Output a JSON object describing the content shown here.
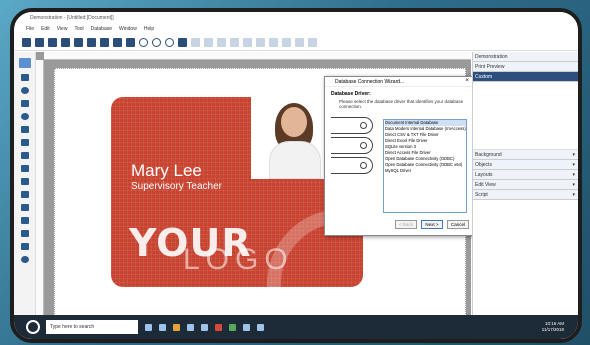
{
  "window": {
    "title": "Demonstration - [Untitled:[Document]]"
  },
  "menu": [
    "File",
    "Edit",
    "View",
    "Tool",
    "Database",
    "Window",
    "Help"
  ],
  "card": {
    "name": "Mary Lee",
    "role": "Supervisory Teacher",
    "logo_line1": "YOUR",
    "logo_line2": "LOGO",
    "bg_color": "#c84330"
  },
  "dialog": {
    "title": "Database Connection Wizard...",
    "close": "×",
    "heading": "Database Driver:",
    "instructions": "Please select the database driver that identifies your database connection.",
    "drivers": [
      "Document Internal Database",
      "Data Modern Internal Database (rmAccess)",
      "Direct CSV & TXT File Driver",
      "Direct Excel File Driver",
      "SQLite version 3",
      "Direct Access File Driver",
      "Open Database Connectivity (ODBC)",
      "Open Database Connectivity (ODBC x64)",
      "MySQL Driver"
    ],
    "selected_index": 0,
    "btn_back": "< Back",
    "btn_next": "Next >",
    "btn_cancel": "Cancel"
  },
  "right_panel": {
    "top": [
      "Demonstration",
      "Print Preview",
      "Custom"
    ],
    "active": "Custom",
    "bottom": [
      "Background",
      "Objects",
      "Layouts",
      "Edit View",
      "Script"
    ],
    "arrow": "▾"
  },
  "taskbar": {
    "search_placeholder": "Type here to search",
    "time": "10:16 AM",
    "date": "11/17/2019"
  }
}
